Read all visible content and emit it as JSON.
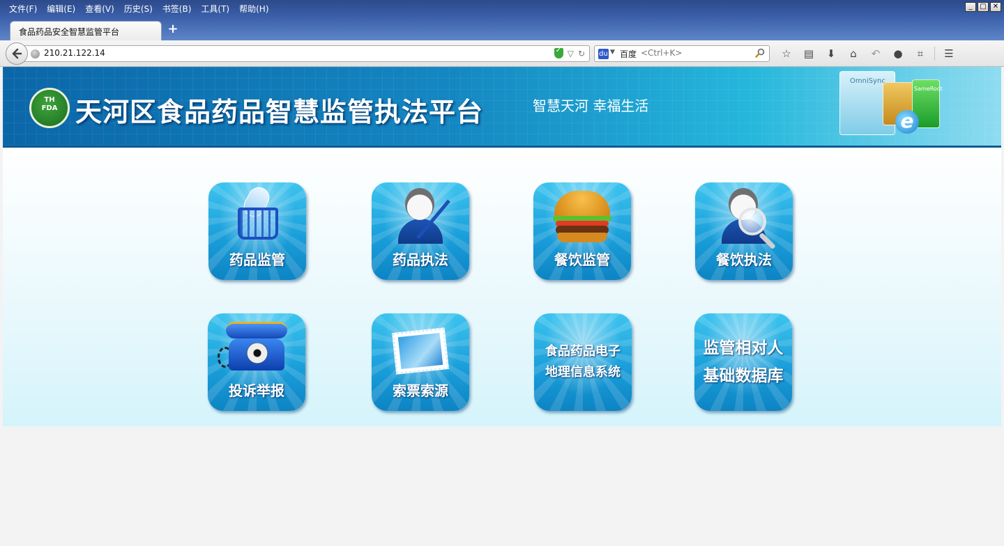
{
  "browser": {
    "menu": [
      "文件(F)",
      "编辑(E)",
      "查看(V)",
      "历史(S)",
      "书签(B)",
      "工具(T)",
      "帮助(H)"
    ],
    "window_controls": [
      "_",
      "□",
      "✕"
    ],
    "tab_title": "食品药品安全智慧监管平台",
    "new_tab_label": "+",
    "url": "210.21.122.14",
    "search_engine": "百度",
    "search_placeholder": "<Ctrl+K>",
    "search_engine_icon_label": "du"
  },
  "banner": {
    "logo_text_top": "TH",
    "logo_text_bottom": "FDA",
    "title": "天河区食品药品智慧监管执法平台",
    "slogan": "智慧天河 幸福生活",
    "deco_card_labels": [
      "OmniSync",
      "SameRoot"
    ],
    "deco_e": "e"
  },
  "tiles": [
    {
      "label": "药品监管",
      "icon": "medicine-basket-icon"
    },
    {
      "label": "药品执法",
      "icon": "officer-pen-icon"
    },
    {
      "label": "餐饮监管",
      "icon": "hamburger-icon"
    },
    {
      "label": "餐饮执法",
      "icon": "inspector-magnifier-icon"
    },
    {
      "label": "投诉举报",
      "icon": "telephone-icon"
    },
    {
      "label": "索票索源",
      "icon": "stamp-icon"
    },
    {
      "label_lines": [
        "食品药品电子",
        "地理信息系统"
      ]
    },
    {
      "label_lines": [
        "监管相对人",
        "基础数据库"
      ]
    }
  ],
  "colors": {
    "tile_blue": "#1a9fda",
    "banner_blue": "#1487c2",
    "titlebar_blue": "#3a5ea8"
  }
}
